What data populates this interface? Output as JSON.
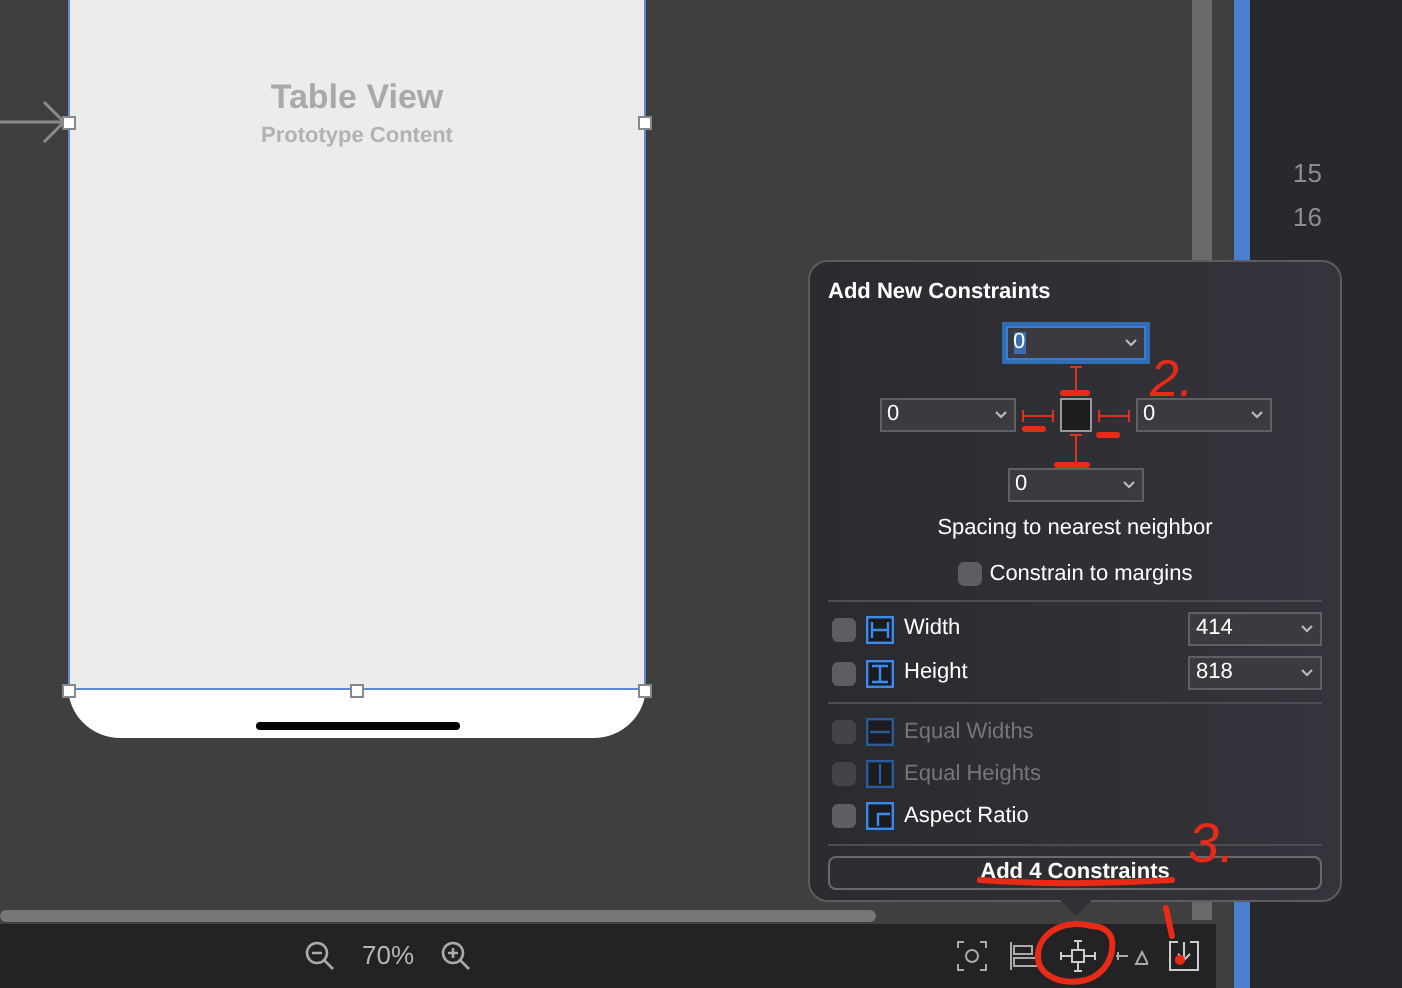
{
  "canvas": {
    "table_title": "Table View",
    "table_subtitle": "Prototype Content"
  },
  "line_numbers": [
    "15",
    "16"
  ],
  "zoom": {
    "text": "70%"
  },
  "popover": {
    "title": "Add New Constraints",
    "spacing": [
      {
        "kind": "top",
        "value": "0",
        "selected": true,
        "on": true
      },
      {
        "kind": "left",
        "value": "0",
        "selected": false,
        "on": true
      },
      {
        "kind": "right",
        "value": "0",
        "selected": false,
        "on": true
      },
      {
        "kind": "bottom",
        "value": "0",
        "selected": false,
        "on": true
      }
    ],
    "spacing_label": "Spacing to nearest neighbor",
    "margins": {
      "label": "Constrain to margins",
      "checked": false
    },
    "size_rows": [
      {
        "kind": "width",
        "label": "Width",
        "checked": false,
        "value": "414"
      },
      {
        "kind": "height",
        "label": "Height",
        "checked": false,
        "value": "818"
      }
    ],
    "relation_rows": [
      {
        "kind": "equal_widths",
        "label": "Equal Widths",
        "checked": false,
        "disabled": true
      },
      {
        "kind": "equal_heights",
        "label": "Equal Heights",
        "checked": false,
        "disabled": true
      },
      {
        "kind": "aspect",
        "label": "Aspect Ratio",
        "checked": false,
        "disabled": false
      }
    ],
    "button": "Add 4 Constraints"
  },
  "annotations": [
    {
      "text": "2."
    },
    {
      "text": "3."
    }
  ]
}
